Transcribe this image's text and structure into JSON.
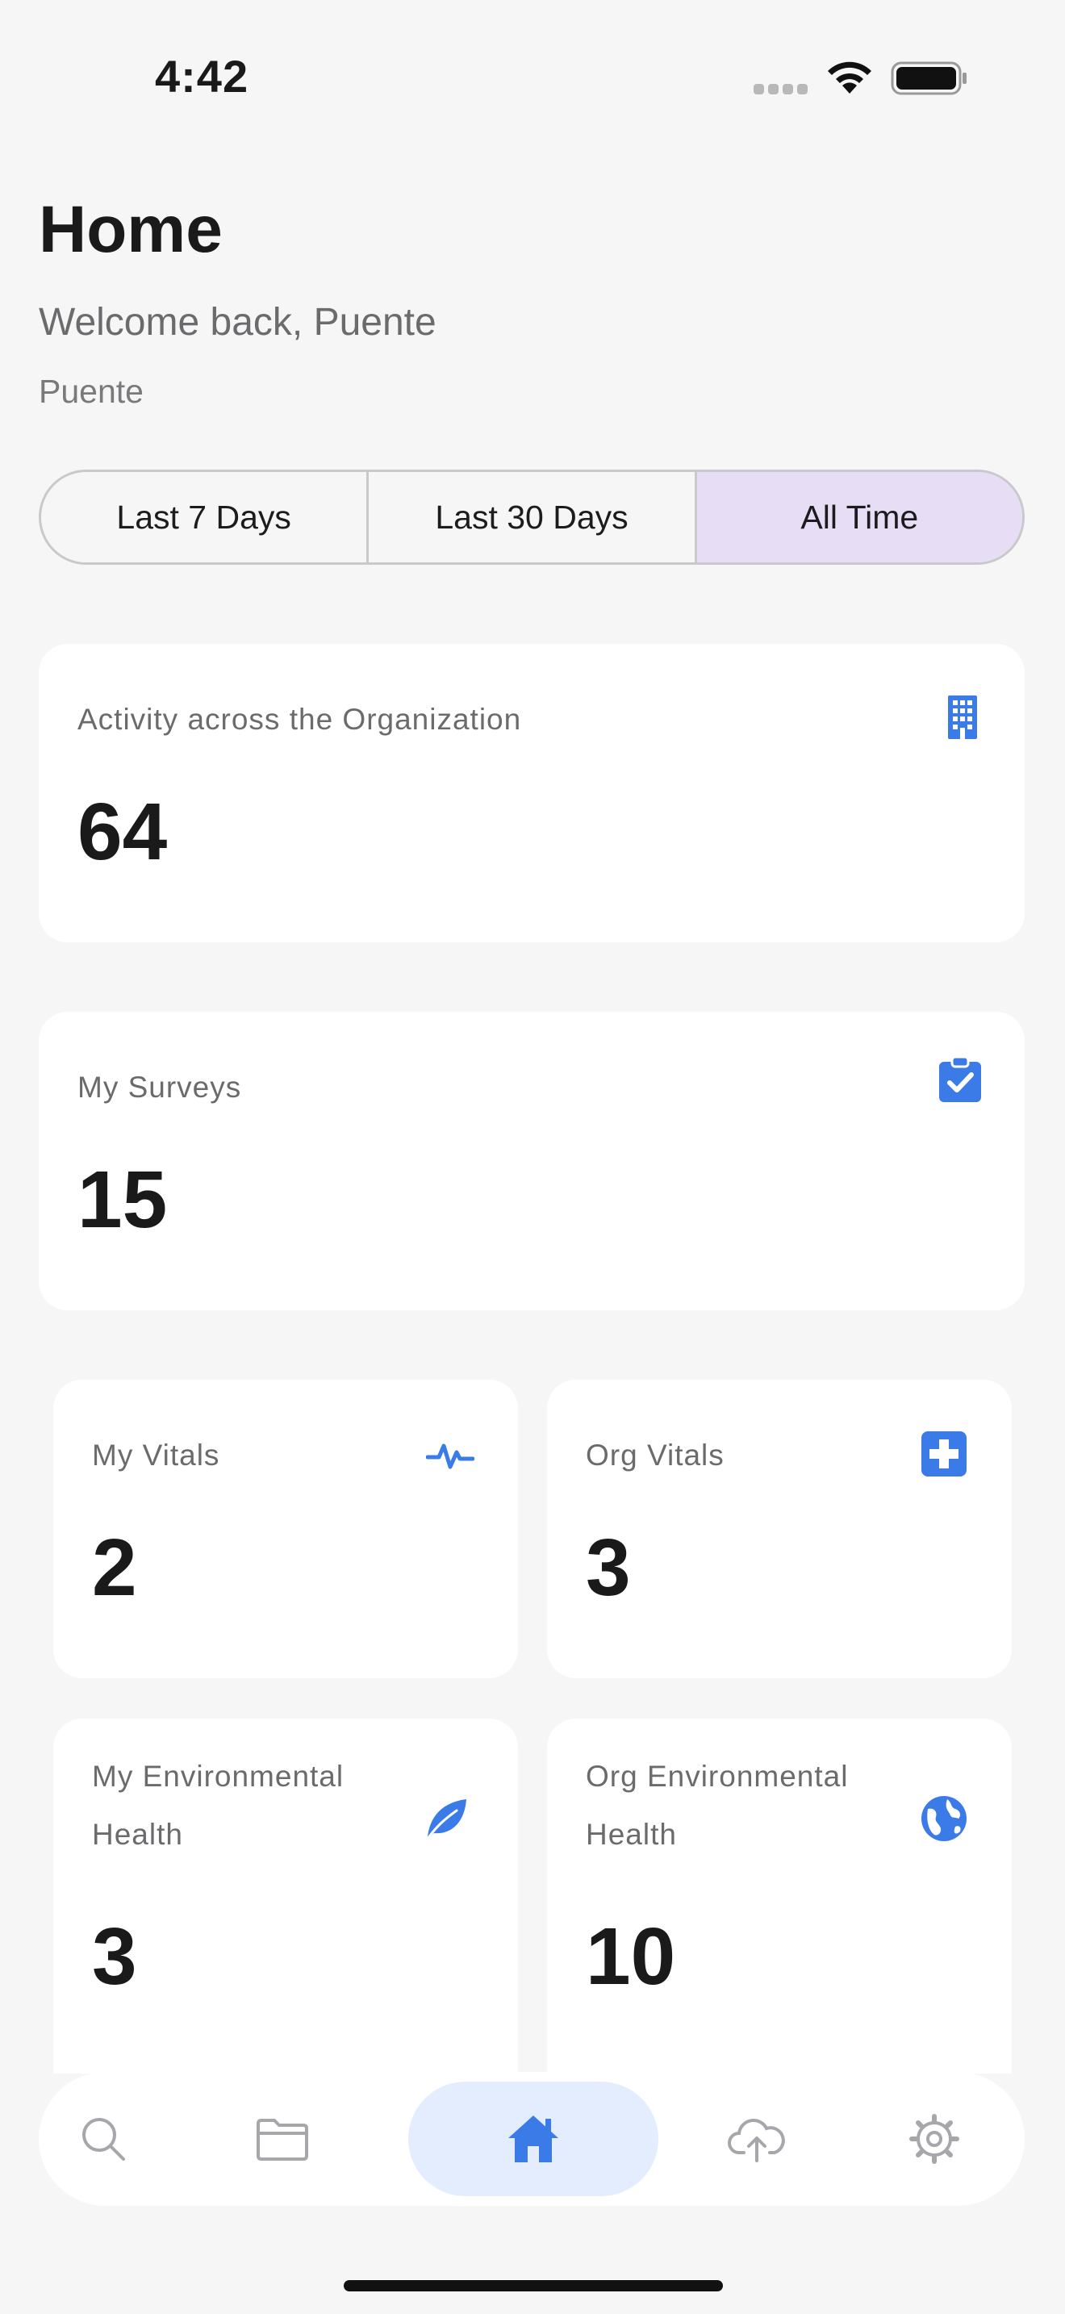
{
  "status_bar": {
    "time": "4:42"
  },
  "header": {
    "title": "Home",
    "welcome": "Welcome back, Puente",
    "organization": "Puente"
  },
  "range_selector": {
    "options": [
      "Last 7 Days",
      "Last 30 Days",
      "All Time"
    ],
    "selected": "All Time"
  },
  "cards": {
    "org_activity": {
      "label": "Activity across the Organization",
      "value": "64",
      "icon": "building-icon"
    },
    "my_surveys": {
      "label": "My Surveys",
      "value": "15",
      "icon": "clipboard-check-icon"
    },
    "my_vitals": {
      "label": "My Vitals",
      "value": "2",
      "icon": "pulse-icon"
    },
    "org_vitals": {
      "label": "Org Vitals",
      "value": "3",
      "icon": "medical-cross-icon"
    },
    "my_env_health": {
      "label_line1": "My Environmental",
      "label_line2": "Health",
      "value": "3",
      "icon": "leaf-icon"
    },
    "org_env_health": {
      "label_line1": "Org Environmental",
      "label_line2": "Health",
      "value": "10",
      "icon": "globe-icon"
    }
  },
  "colors": {
    "accent": "#3b7be8",
    "selected_segment": "#e7def5",
    "nav_active": "#e3edfd"
  },
  "bottom_nav": {
    "items": [
      "search-icon",
      "folder-icon",
      "home-icon",
      "cloud-upload-icon",
      "gear-icon"
    ],
    "active": "home-icon"
  }
}
